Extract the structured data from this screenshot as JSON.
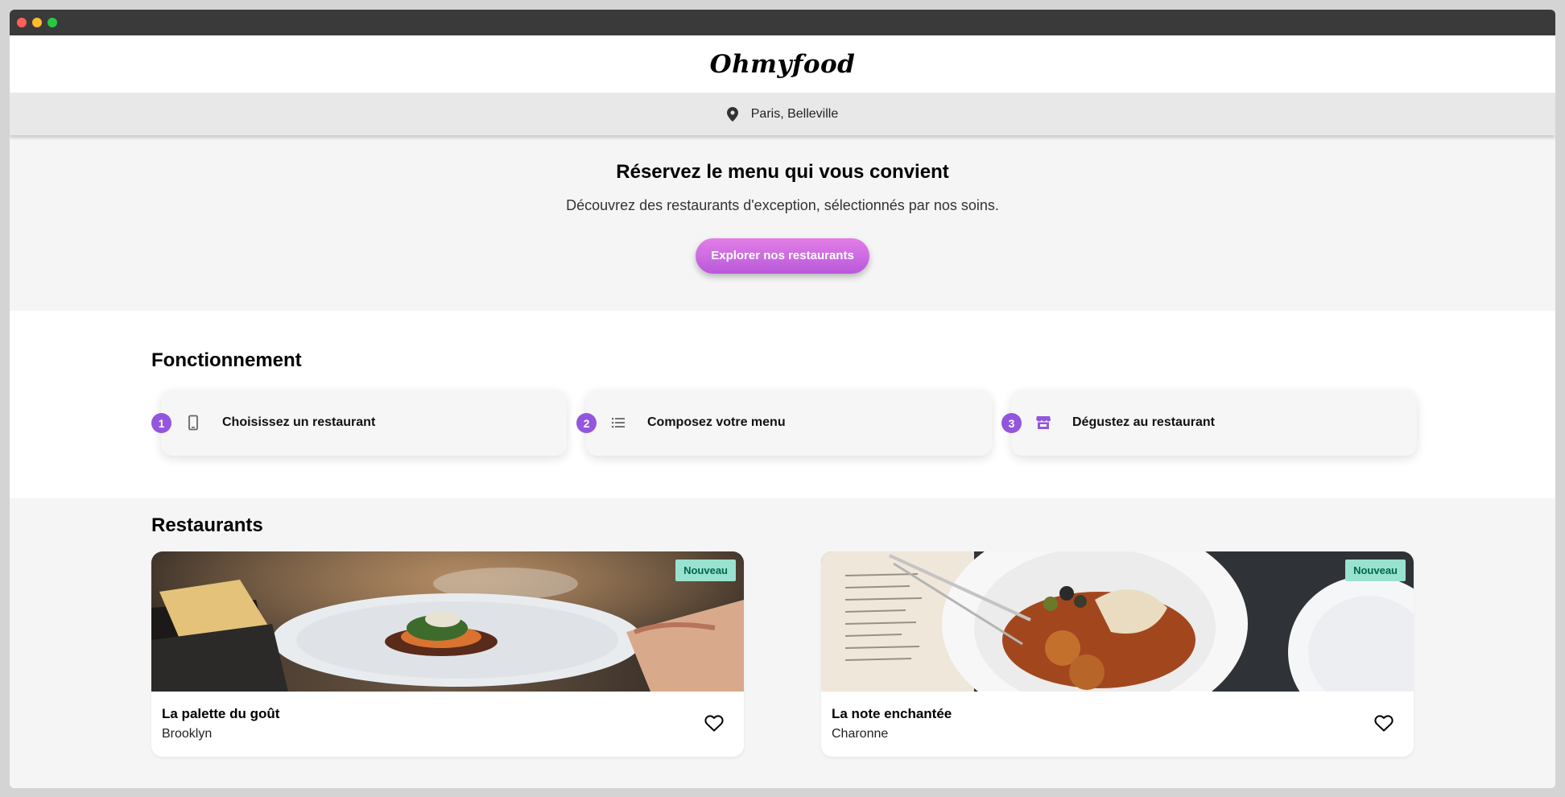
{
  "window": {
    "controls": [
      "close",
      "minimize",
      "maximize"
    ]
  },
  "header": {
    "logo": "Ohmyfood"
  },
  "location": {
    "icon": "location-pin-icon",
    "text": "Paris, Belleville"
  },
  "hero": {
    "title": "Réservez le menu qui vous convient",
    "subtitle": "Découvrez des restaurants d'exception, sélectionnés par nos soins.",
    "cta_label": "Explorer nos restaurants"
  },
  "how": {
    "title": "Fonctionnement",
    "steps": [
      {
        "number": "1",
        "icon": "mobile-phone-icon",
        "label": "Choisissez un restaurant"
      },
      {
        "number": "2",
        "icon": "list-icon",
        "label": "Composez votre menu"
      },
      {
        "number": "3",
        "icon": "store-icon",
        "label": "Dégustez au restaurant"
      }
    ]
  },
  "restaurants": {
    "title": "Restaurants",
    "items": [
      {
        "name": "La palette du goût",
        "location": "Brooklyn",
        "badge": "Nouveau",
        "image": "plated-fish-dish-photo"
      },
      {
        "name": "La note enchantée",
        "location": "Charonne",
        "badge": "Nouveau",
        "image": "tapas-plate-with-menu-photo"
      }
    ]
  },
  "colors": {
    "accent_purple": "#9356dc",
    "cta_gradient_start": "#e27ee6",
    "cta_gradient_end": "#b959db",
    "badge_bg": "#99e2d0",
    "badge_text": "#00664d"
  }
}
